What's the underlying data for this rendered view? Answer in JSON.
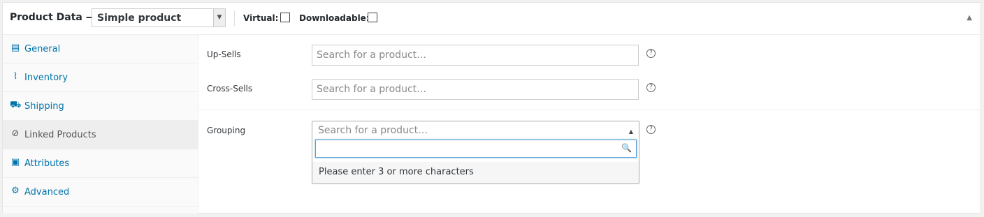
{
  "header": {
    "title": "Product Data —",
    "product_type": "Simple product",
    "virtual_label": "Virtual:",
    "downloadable_label": "Downloadable:",
    "collapse_icon": "triangle-up-icon"
  },
  "tabs": [
    {
      "label": "General",
      "icon": "general-icon"
    },
    {
      "label": "Inventory",
      "icon": "inventory-icon"
    },
    {
      "label": "Shipping",
      "icon": "shipping-icon"
    },
    {
      "label": "Linked Products",
      "icon": "link-icon",
      "active": true
    },
    {
      "label": "Attributes",
      "icon": "attributes-icon"
    },
    {
      "label": "Advanced",
      "icon": "gear-icon"
    }
  ],
  "fields": {
    "upsells": {
      "label": "Up-Sells",
      "placeholder": "Search for a product…"
    },
    "crosssells": {
      "label": "Cross-Sells",
      "placeholder": "Search for a product…"
    },
    "grouping": {
      "label": "Grouping",
      "placeholder": "Search for a product…"
    }
  },
  "dropdown": {
    "search_value": "",
    "message": "Please enter 3 or more characters"
  },
  "colors": {
    "link": "#0073aa",
    "focus_border": "#5b9dd9"
  }
}
